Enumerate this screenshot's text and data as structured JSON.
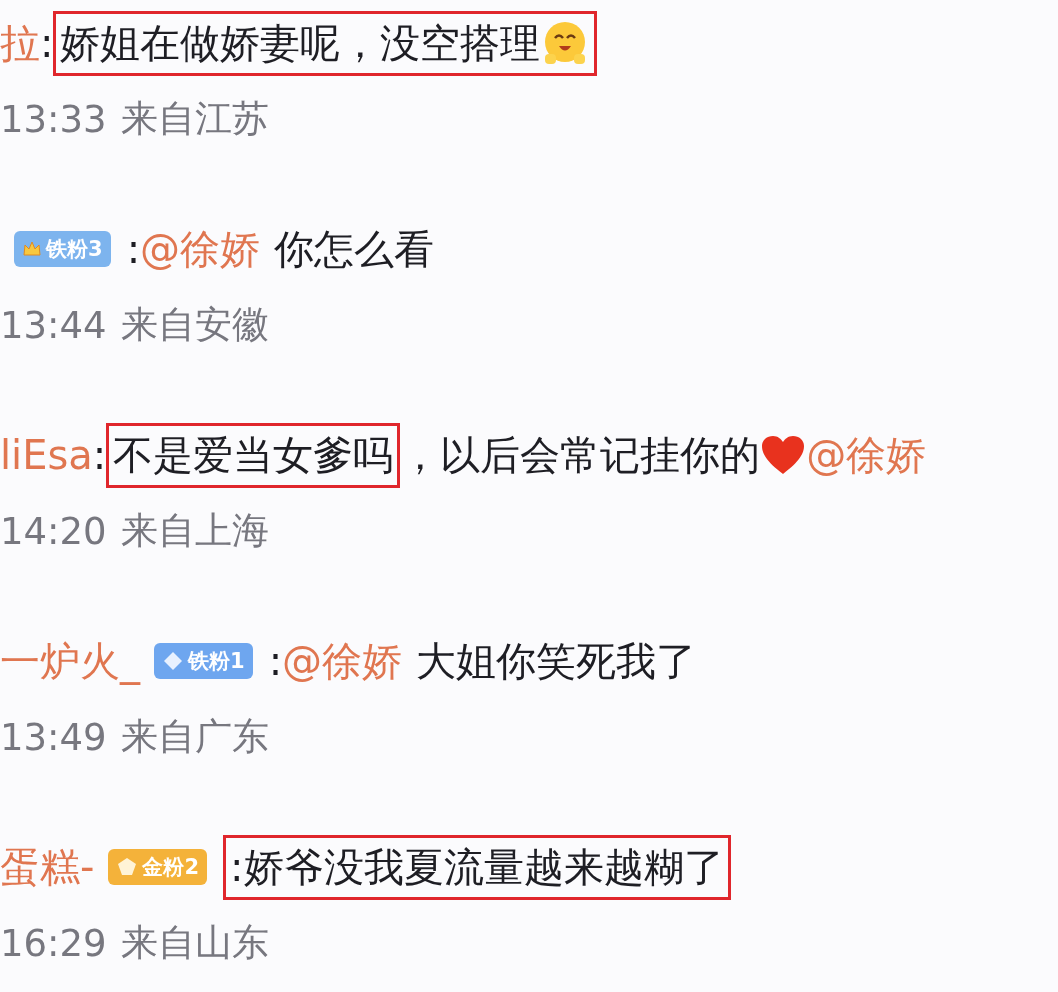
{
  "comments": [
    {
      "user": "拉",
      "parts": [
        {
          "kind": "text",
          "text": ":"
        },
        {
          "kind": "box",
          "children": [
            {
              "kind": "text",
              "text": "娇姐在做娇妻呢，没空搭理"
            },
            {
              "kind": "smile"
            }
          ]
        }
      ],
      "time": "13:33",
      "location": "来自江苏"
    },
    {
      "badge": {
        "label": "铁粉3",
        "color": "#7db4ee",
        "kind": "crown"
      },
      "parts": [
        {
          "kind": "text",
          "text": ":"
        },
        {
          "kind": "mention",
          "text": "@徐娇"
        },
        {
          "kind": "text",
          "text": "你怎么看"
        }
      ],
      "time": "13:44",
      "location": "来自安徽"
    },
    {
      "user": "liEsa",
      "parts": [
        {
          "kind": "text",
          "text": ":"
        },
        {
          "kind": "box",
          "children": [
            {
              "kind": "text",
              "text": "不是爱当女爹吗"
            }
          ]
        },
        {
          "kind": "text",
          "text": "，以后会常记挂你的"
        },
        {
          "kind": "heart"
        },
        {
          "kind": "mention",
          "text": "@徐娇"
        }
      ],
      "time": "14:20",
      "location": "来自上海"
    },
    {
      "user": "一炉火_",
      "badge": {
        "label": "铁粉1",
        "color": "#6ea6ef",
        "kind": "diamond"
      },
      "parts": [
        {
          "kind": "text",
          "text": ":"
        },
        {
          "kind": "mention",
          "text": "@徐娇"
        },
        {
          "kind": "text",
          "text": "大姐你笑死我了"
        }
      ],
      "time": "13:49",
      "location": "来自广东"
    },
    {
      "user": "蛋糕-",
      "badge": {
        "label": "金粉2",
        "color": "#f4b23a",
        "kind": "gem"
      },
      "parts": [
        {
          "kind": "box",
          "children": [
            {
              "kind": "text",
              "text": ":娇爷没我夏流量越来越糊了"
            }
          ]
        }
      ],
      "time": "16:29",
      "location": "来自山东"
    }
  ]
}
